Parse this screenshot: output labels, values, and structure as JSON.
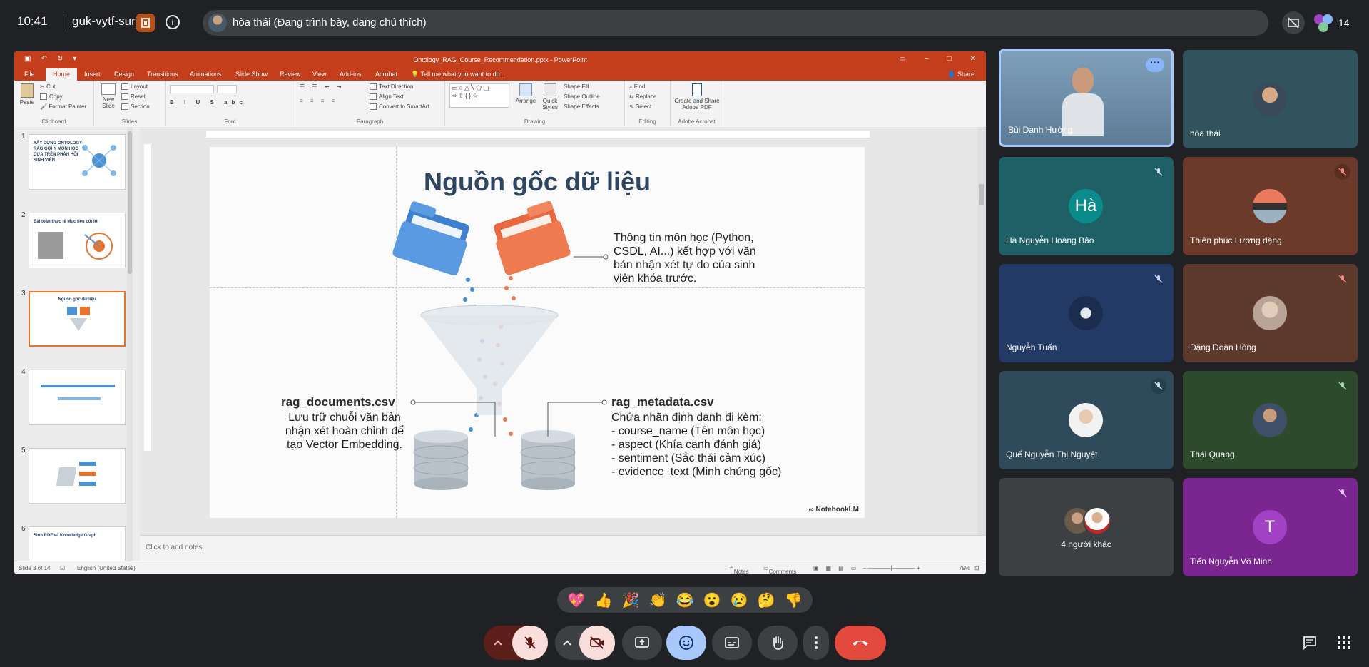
{
  "topbar": {
    "time": "10:41",
    "meeting_code": "guk-vytf-sur",
    "presenter_status": "hòa thái (Đang trình bày, đang chú thích)",
    "participant_count": "14"
  },
  "powerpoint": {
    "file_title": "Ontology_RAG_Course_Recommendation.pptx - PowerPoint",
    "tabs": [
      "File",
      "Home",
      "Insert",
      "Design",
      "Transitions",
      "Animations",
      "Slide Show",
      "Review",
      "View",
      "Add-ins",
      "Acrobat"
    ],
    "active_tab": "Home",
    "tell_me": "Tell me what you want to do...",
    "share": "Share",
    "ribbon": {
      "paste": "Paste",
      "cut": "Cut",
      "copy": "Copy",
      "format_painter": "Format Painter",
      "clipboard": "Clipboard",
      "new_slide": "New Slide",
      "layout": "Layout",
      "reset": "Reset",
      "section": "Section",
      "slides": "Slides",
      "font": "Font",
      "text_direction": "Text Direction",
      "align_text": "Align Text",
      "convert_smartart": "Convert to SmartArt",
      "paragraph": "Paragraph",
      "arrange": "Arrange",
      "quick_styles": "Quick Styles",
      "shape_fill": "Shape Fill",
      "shape_outline": "Shape Outline",
      "shape_effects": "Shape Effects",
      "drawing": "Drawing",
      "find": "Find",
      "replace": "Replace",
      "select": "Select",
      "editing": "Editing",
      "create_pdf": "Create and Share Adobe PDF",
      "adobe_acrobat": "Adobe Acrobat"
    },
    "thumbnails": [
      {
        "num": "1",
        "title": "XÂY DỰNG ONTOLOGY RAG GỢI Ý MÔN HỌC DỰA TRÊN PHẢN HỒI SINH VIÊN"
      },
      {
        "num": "2",
        "title": "Bài toán thực tế    Mục tiêu cốt lõi"
      },
      {
        "num": "3",
        "title": "Nguồn gốc dữ liệu"
      },
      {
        "num": "4",
        "title": ""
      },
      {
        "num": "5",
        "title": ""
      },
      {
        "num": "6",
        "title": "Sinh RDF và Knowledge Graph"
      }
    ],
    "slide": {
      "title": "Nguồn gốc dữ liệu",
      "top_right_text": [
        "Thông tin môn học (Python,",
        "CSDL, AI...) kết hợp với văn",
        "bản nhận xét tự do của sinh",
        "viên khóa trước."
      ],
      "left_head": "rag_documents.csv",
      "left_text": [
        "Lưu trữ chuỗi văn bản",
        "nhận xét hoàn chỉnh để",
        "tạo Vector Embedding."
      ],
      "right_head": "rag_metadata.csv",
      "right_text": [
        "Chứa nhãn định danh đi kèm:",
        "- course_name (Tên môn học)",
        "- aspect (Khía cạnh đánh giá)",
        "- sentiment (Sắc thái cảm xúc)",
        "- evidence_text (Minh chứng gốc)"
      ],
      "watermark": "NotebookLM"
    },
    "notes_placeholder": "Click to add notes",
    "status": {
      "slide_of": "Slide 3 of 14",
      "language": "English (United States)",
      "notes": "Notes",
      "comments": "Comments",
      "zoom": "79%"
    }
  },
  "participants": [
    {
      "name": "Bùi Danh Hường",
      "muted": false,
      "speaking": true,
      "bg": "#6f8da8"
    },
    {
      "name": "hòa thái",
      "muted": false,
      "speaking": false,
      "bg": "#31535d"
    },
    {
      "name": "Hà Nguyễn Hoàng Bảo",
      "muted": true,
      "letter": "Hà",
      "bg": "#1f5f66",
      "avatar": "#0b8c8c"
    },
    {
      "name": "Thiên phúc Lương đặng",
      "muted": true,
      "bg": "#6b3a2a"
    },
    {
      "name": "Nguyễn Tuấn",
      "muted": true,
      "bg": "#243a66"
    },
    {
      "name": "Đặng Đoàn Hồng",
      "muted": true,
      "bg": "#5d3a2c"
    },
    {
      "name": "Quế Nguyễn Thị Nguyệt",
      "muted": true,
      "bg": "#2f4a5a"
    },
    {
      "name": "Thái Quang",
      "muted": true,
      "bg": "#2e4a2c"
    },
    {
      "name": "4 người khác",
      "muted": false,
      "bg": "#3c4043"
    },
    {
      "name": "Tiến Nguyễn Võ Minh",
      "muted": true,
      "letter": "T",
      "bg": "#7b2690",
      "avatar": "#a142c4"
    }
  ],
  "reactions": [
    "💖",
    "👍",
    "🎉",
    "👏",
    "😂",
    "😮",
    "😢",
    "🤔",
    "👎"
  ],
  "colors": {
    "accent_blue": "#a8c7fa",
    "leave_red": "#e34a3d",
    "mic_off_bg": "#f9dedc",
    "ppt_orange": "#c43e1c"
  }
}
